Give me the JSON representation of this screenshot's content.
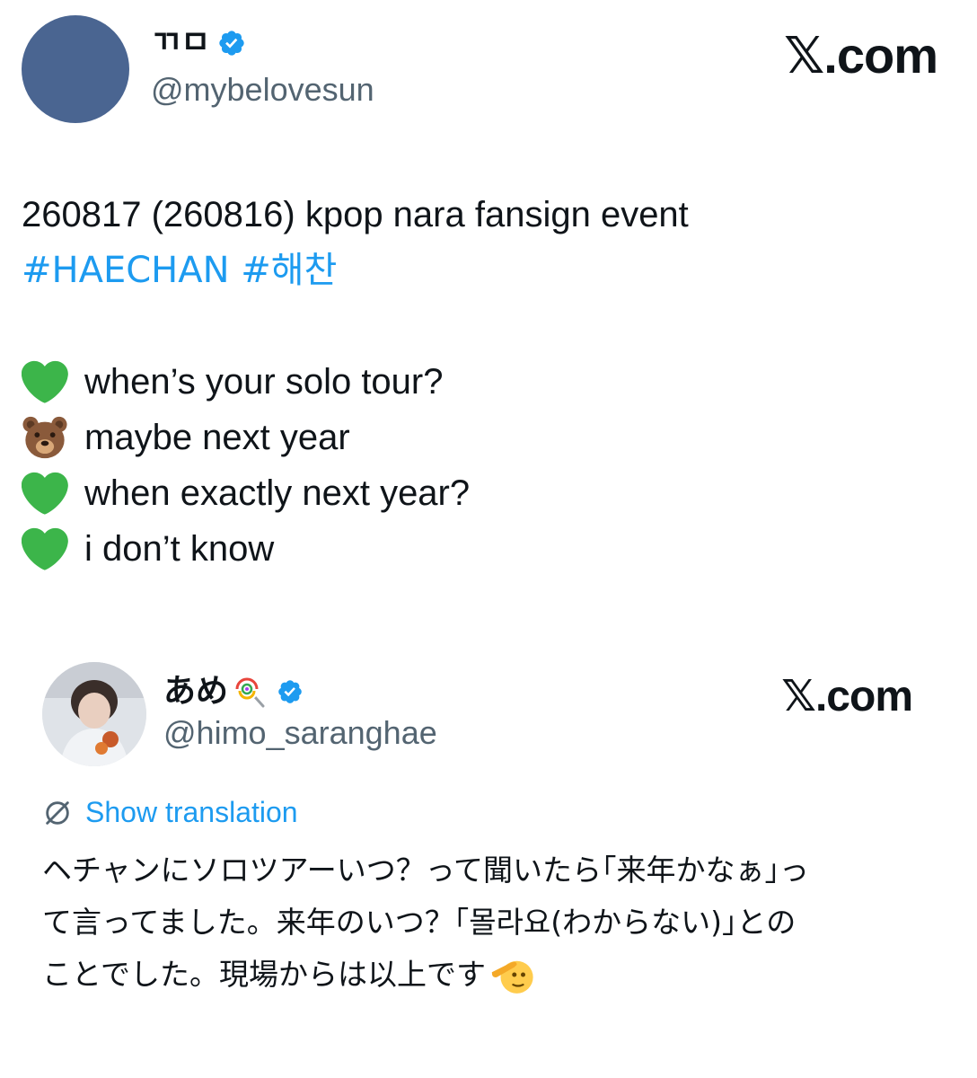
{
  "main_tweet": {
    "display_name": "ㄲㅁ",
    "handle": "@mybelovesun",
    "brand": "𝕏.com",
    "avatar_color": "#4a6591",
    "verified_icon": "verified-badge-icon",
    "lines": {
      "event": "260817 (260816) kpop nara fansign event",
      "hashtags": "#HAECHAN #해찬",
      "dialogue": [
        {
          "icon": "green-heart-icon",
          "text": "when’s your solo tour?"
        },
        {
          "icon": "bear-face-icon",
          "text": "maybe next year"
        },
        {
          "icon": "green-heart-icon",
          "text": "when exactly next year?"
        },
        {
          "icon": "green-heart-icon",
          "text": "i don’t know"
        }
      ]
    }
  },
  "quoted_tweet": {
    "display_name": "あめ",
    "name_emoji": "lollipop-icon",
    "handle": "@himo_saranghae",
    "brand": "𝕏.com",
    "show_translation": "Show translation",
    "translate_icon": "globe-slash-icon",
    "lines": [
      "ヘチャンにソロツアーいつ？って聞いたら｢来年かなぁ｣っ",
      "て言ってました。来年のいつ？｢몰라요(わからない)｣との",
      "ことでした。現場からは以上です"
    ],
    "trailing_emoji": "saluting-face-icon"
  },
  "colors": {
    "link": "#1d9bf0",
    "secondary_text": "#536471",
    "verified": "#1d9bf0",
    "green_heart": "#3cb54a"
  }
}
